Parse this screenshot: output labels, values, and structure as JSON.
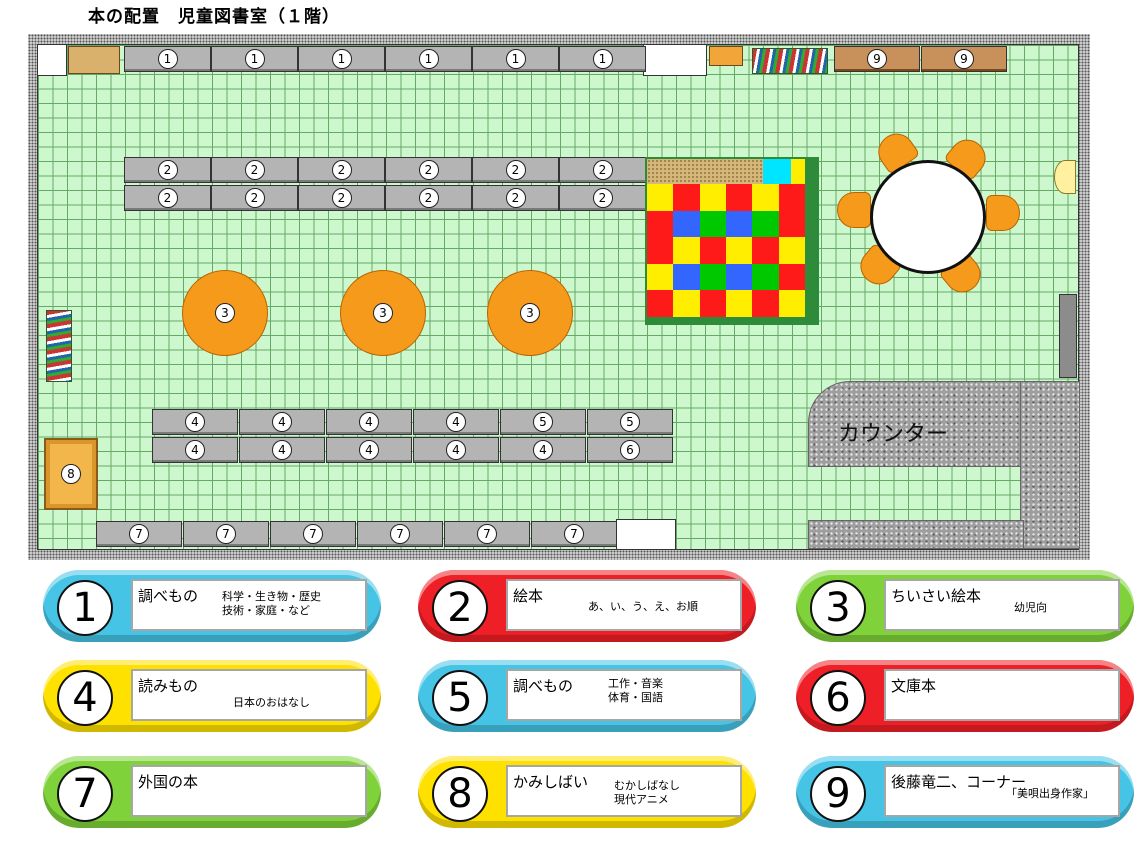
{
  "title": "本の配置　児童図書室（１階）",
  "shelves": {
    "top_row": [
      "1",
      "1",
      "1",
      "1",
      "1",
      "1"
    ],
    "top_right": [
      "9",
      "9"
    ],
    "row2a": [
      "2",
      "2",
      "2",
      "2",
      "2",
      "2"
    ],
    "row2b": [
      "2",
      "2",
      "2",
      "2",
      "2",
      "2"
    ],
    "tables": [
      "3",
      "3",
      "3"
    ],
    "row4a": [
      "4",
      "4",
      "4",
      "4",
      "5",
      "5"
    ],
    "row4b": [
      "4",
      "4",
      "4",
      "4",
      "4",
      "6"
    ],
    "bottom_row": [
      "7",
      "7",
      "7",
      "7",
      "7",
      "7"
    ],
    "left_box": "8"
  },
  "counter_label": "カウンター",
  "legend": [
    {
      "num": "1",
      "title": "調べもの",
      "sub": "科学・生き物・歴史\n技術・家庭・など",
      "color": "blue"
    },
    {
      "num": "2",
      "title": "絵本",
      "sub": "あ、い、う、え、お順",
      "color": "red"
    },
    {
      "num": "3",
      "title": "ちいさい絵本",
      "sub": "幼児向",
      "color": "green"
    },
    {
      "num": "4",
      "title": "読みもの",
      "sub": "日本のおはなし",
      "color": "yellow"
    },
    {
      "num": "5",
      "title": "調べもの",
      "sub": "工作・音楽\n体育・国語",
      "color": "blue"
    },
    {
      "num": "6",
      "title": "文庫本",
      "sub": "",
      "color": "red"
    },
    {
      "num": "7",
      "title": "外国の本",
      "sub": "",
      "color": "green"
    },
    {
      "num": "8",
      "title": "かみしばい",
      "sub": "むかしばなし\n現代アニメ",
      "color": "yellow"
    },
    {
      "num": "9",
      "title": "後藤竜二、コーナー",
      "sub": "「美唄出身作家」",
      "color": "blue"
    }
  ]
}
